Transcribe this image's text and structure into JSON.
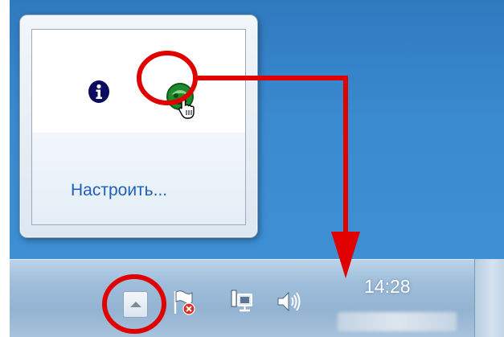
{
  "flyout": {
    "customize_label": "Настроить...",
    "icons": [
      {
        "name": "info-icon"
      },
      {
        "name": "green-app-icon"
      }
    ]
  },
  "taskbar": {
    "clock_time": "14:28",
    "tray_icons": [
      "show-hidden-icons-arrow",
      "action-center-flag-icon",
      "network-icon",
      "volume-icon"
    ]
  },
  "colors": {
    "annotation": "#e00000",
    "link": "#1e5fb8",
    "desktop": "#3a8ad0"
  }
}
